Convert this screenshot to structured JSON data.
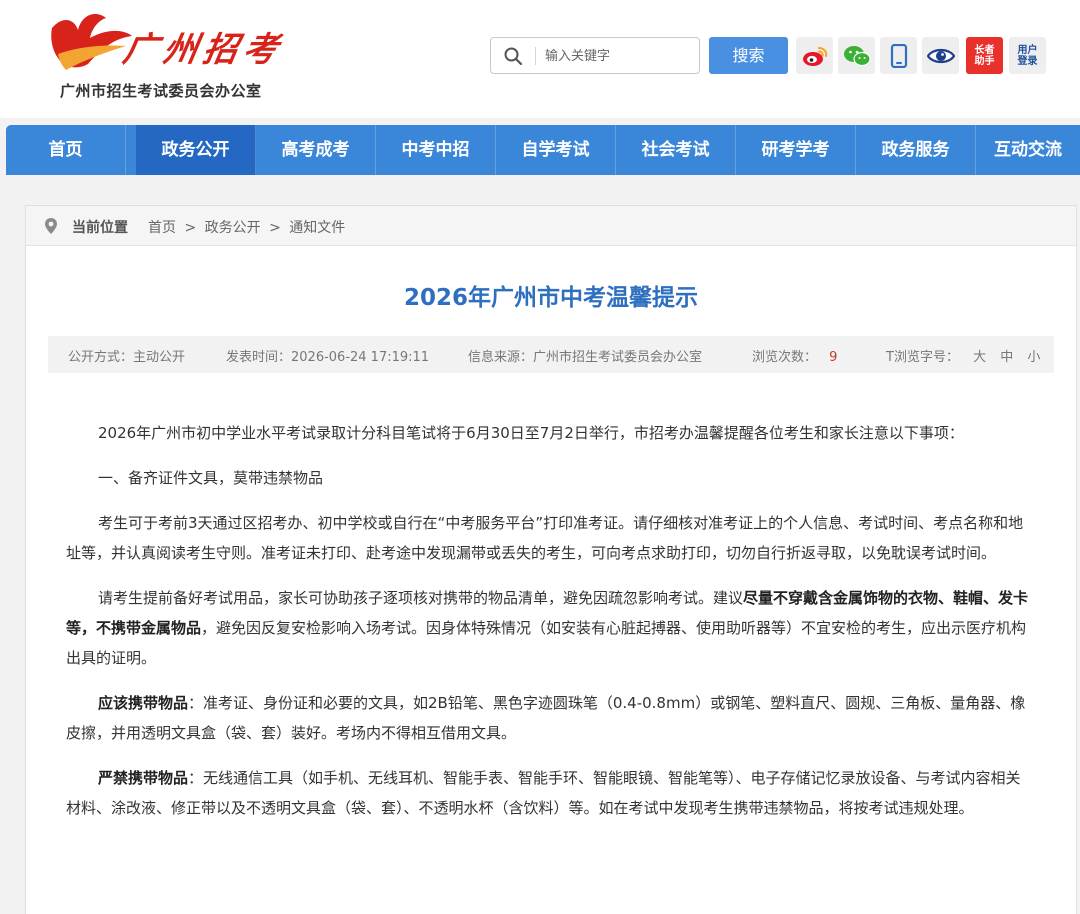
{
  "header": {
    "logo_text": "广州招考",
    "org_name": "广州市招生考试委员会办公室",
    "search_placeholder": "输入关键字",
    "search_button": "搜索",
    "tools": [
      {
        "name": "weibo",
        "icon": "weibo-icon"
      },
      {
        "name": "wechat",
        "icon": "wechat-icon"
      },
      {
        "name": "mobile",
        "icon": "mobile-icon"
      },
      {
        "name": "eye",
        "icon": "eye-icon"
      },
      {
        "name": "elder_helper",
        "label_line1": "长者",
        "label_line2": "助手"
      },
      {
        "name": "user_login",
        "label_line1": "用户",
        "label_line2": "登录"
      }
    ]
  },
  "nav": {
    "items": [
      "首页",
      "政务公开",
      "高考成考",
      "中考中招",
      "自学考试",
      "社会考试",
      "研考学考",
      "政务服务",
      "互动交流"
    ],
    "active_index": 1
  },
  "breadcrumb": {
    "label": "当前位置",
    "items": [
      "首页",
      "政务公开",
      "通知文件"
    ],
    "separator": ">"
  },
  "article": {
    "title": "2026年广州市中考温馨提示",
    "meta": {
      "open_mode": "公开方式：主动公开",
      "publish_time": "发表时间：2026-06-24 17:19:11",
      "source": "信息来源：广州市招生考试委员会办公室",
      "views_label": "浏览次数：",
      "views": "9",
      "font_label": "T浏览字号：",
      "font_large": "大",
      "font_medium": "中",
      "font_small": "小"
    },
    "p1": "2026年广州市初中学业水平考试录取计分科目笔试将于6月30日至7月2日举行，市招考办温馨提醒各位考生和家长注意以下事项：",
    "p2": "一、备齐证件文具，莫带违禁物品",
    "p3": "考生可于考前3天通过区招考办、初中学校或自行在“中考服务平台”打印准考证。请仔细核对准考证上的个人信息、考试时间、考点名称和地址等，并认真阅读考生守则。准考证未打印、赴考途中发现漏带或丢失的考生，可向考点求助打印，切勿自行折返寻取，以免耽误考试时间。",
    "p4_a": "请考生提前备好考试用品，家长可协助孩子逐项核对携带的物品清单，避免因疏忽影响考试。建议",
    "p4_bold": "尽量不穿戴含金属饰物的衣物、鞋帽、发卡等，不携带金属物品",
    "p4_b": "，避免因反复安检影响入场考试。因身体特殊情况（如安装有心脏起搏器、使用助听器等）不宜安检的考生，应出示医疗机构出具的证明。",
    "p5_bold": "应该携带物品",
    "p5": "：准考证、身份证和必要的文具，如2B铅笔、黑色字迹圆珠笔（0.4-0.8mm）或钢笔、塑料直尺、圆规、三角板、量角器、橡皮擦，并用透明文具盒（袋、套）装好。考场内不得相互借用文具。",
    "p6_bold": "严禁携带物品",
    "p6": "：无线通信工具（如手机、无线耳机、智能手表、智能手环、智能眼镜、智能笔等）、电子存储记忆录放设备、与考试内容相关材料、涂改液、修正带以及不透明文具盒（袋、套）、不透明水杯（含饮料）等。如在考试中发现考生携带违禁物品，将按考试违规处理。"
  },
  "colors": {
    "nav_bg": "#3a86d8",
    "nav_active": "#2468c4",
    "title": "#2e6fc0",
    "brand_red": "#d8231b",
    "search_btn": "#4a90e2"
  }
}
